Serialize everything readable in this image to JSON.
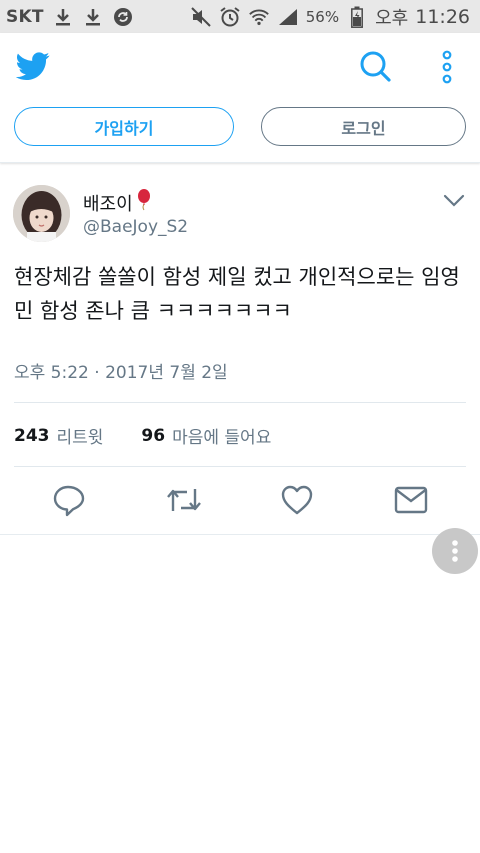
{
  "status_bar": {
    "carrier": "SKT",
    "battery_percent": "56%",
    "ampm": "오후",
    "time": "11:26"
  },
  "header": {
    "signup_label": "가입하기",
    "login_label": "로그인"
  },
  "tweet": {
    "display_name": "배조이",
    "handle": "@BaeJoy_S2",
    "text": "현장체감 쏠쏠이 함성 제일 컸고 개인적으로는 임영민 함성 존나 큼 ㅋㅋㅋㅋㅋㅋㅋ",
    "timestamp": "오후 5:22 · 2017년 7월 2일",
    "retweet_count": "243",
    "retweet_label": "리트윗",
    "like_count": "96",
    "like_label": "마음에 들어요"
  },
  "colors": {
    "brand": "#1da1f2",
    "secondary_text": "#657786"
  },
  "icons": {
    "status_left": [
      "download-icon",
      "download-icon",
      "sync-icon"
    ],
    "status_right": [
      "mute-icon",
      "alarm-icon",
      "wifi-icon",
      "signal-icon",
      "battery-icon"
    ],
    "tweet_actions": [
      "reply-icon",
      "retweet-icon",
      "like-icon",
      "dm-icon"
    ]
  }
}
